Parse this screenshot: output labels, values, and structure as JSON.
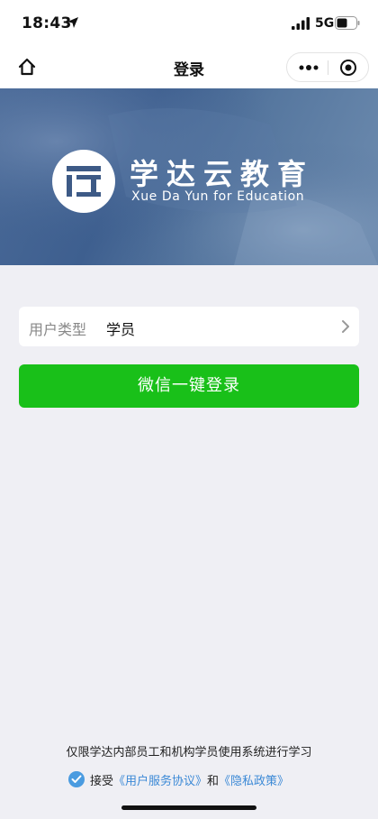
{
  "status_bar": {
    "time": "18:43",
    "network": "5G",
    "icons": [
      "location-arrow-icon",
      "signal-bars-icon",
      "battery-icon"
    ]
  },
  "nav": {
    "title": "登录",
    "icons": [
      "home-icon",
      "more-dots-icon",
      "close-circle-icon"
    ]
  },
  "banner": {
    "brand_name": "学达云教育",
    "brand_en": "Xue Da Yun for Education",
    "logo_icon": "xueda-logo-icon"
  },
  "form": {
    "user_type_label": "用户类型",
    "user_type_value": "学员",
    "login_button": "微信一键登录"
  },
  "footer": {
    "note": "仅限学达内部员工和机构学员使用系统进行学习",
    "accept": "接受",
    "user_agreement": "《用户服务协议》",
    "and": "和",
    "privacy_policy": "《隐私政策》",
    "agreement_checked": true
  },
  "colors": {
    "primary_green": "#19c019",
    "link_blue": "#3b89d6",
    "banner_blue": "#3e5f8f",
    "background": "#efeff4"
  }
}
